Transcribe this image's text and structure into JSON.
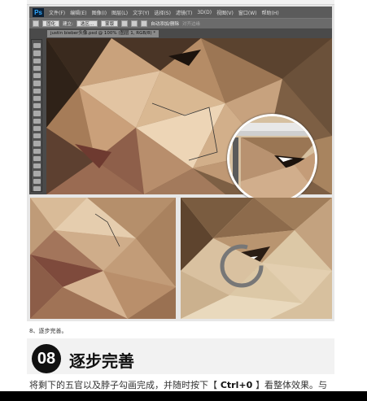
{
  "photoshop": {
    "logo": "Ps",
    "menus": [
      "文件(F)",
      "编辑(E)",
      "图像(I)",
      "图层(L)",
      "文字(Y)",
      "选择(S)",
      "滤镜(T)",
      "3D(D)",
      "视图(V)",
      "窗口(W)",
      "帮助(H)"
    ],
    "options_bar": {
      "mode_value": "固化",
      "brush_label": "建立:",
      "brush_value": "选区...",
      "shape_label": "蒙版",
      "auto_add_label": "自动添加/删除",
      "align_edges_label": "对齐边缘"
    },
    "document_tab": "justin bieber头像.psd @ 100% (图层 1, RGB/8) *"
  },
  "article": {
    "step_caption": "8、逐步完善。",
    "step_number": "08",
    "step_title": "逐步完善",
    "body_text_1": "将剩下的五官以及脖子勾画完成，并随时按下【",
    "body_shortcut": " Ctrl+0 ",
    "body_text_2": "】看整体效果。与"
  }
}
